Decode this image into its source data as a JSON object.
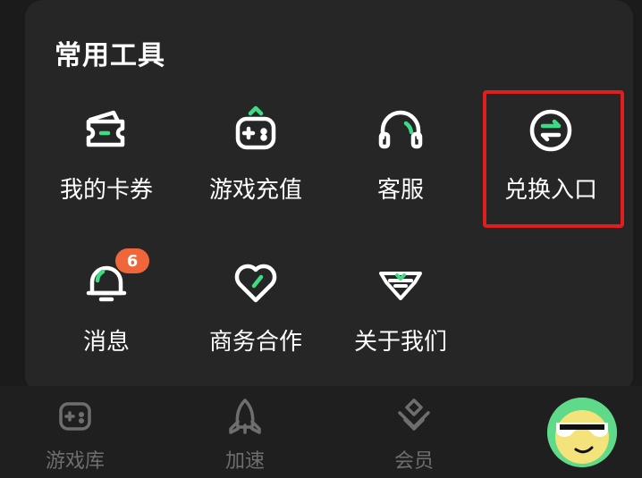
{
  "panel": {
    "title": "常用工具"
  },
  "tools": [
    {
      "label": "我的卡券",
      "icon": "card-coupon-icon"
    },
    {
      "label": "游戏充值",
      "icon": "gamepad-recharge-icon"
    },
    {
      "label": "客服",
      "icon": "headset-icon"
    },
    {
      "label": "兑换入口",
      "icon": "exchange-icon",
      "highlighted": true
    },
    {
      "label": "消息",
      "icon": "bell-icon",
      "badge": "6"
    },
    {
      "label": "商务合作",
      "icon": "heart-handshake-icon"
    },
    {
      "label": "关于我们",
      "icon": "logo-wings-icon"
    }
  ],
  "bottom_nav": [
    {
      "label": "游戏库",
      "icon": "gamepad-icon"
    },
    {
      "label": "加速",
      "icon": "rocket-icon"
    },
    {
      "label": "会员",
      "icon": "vip-diamond-icon"
    }
  ],
  "colors": {
    "background": "#1b1b1b",
    "panel": "#262626",
    "accent_green": "#3ddc84",
    "badge": "#f0663a",
    "highlight_border": "#e01e1e",
    "nav_inactive": "#6e6e6e"
  }
}
